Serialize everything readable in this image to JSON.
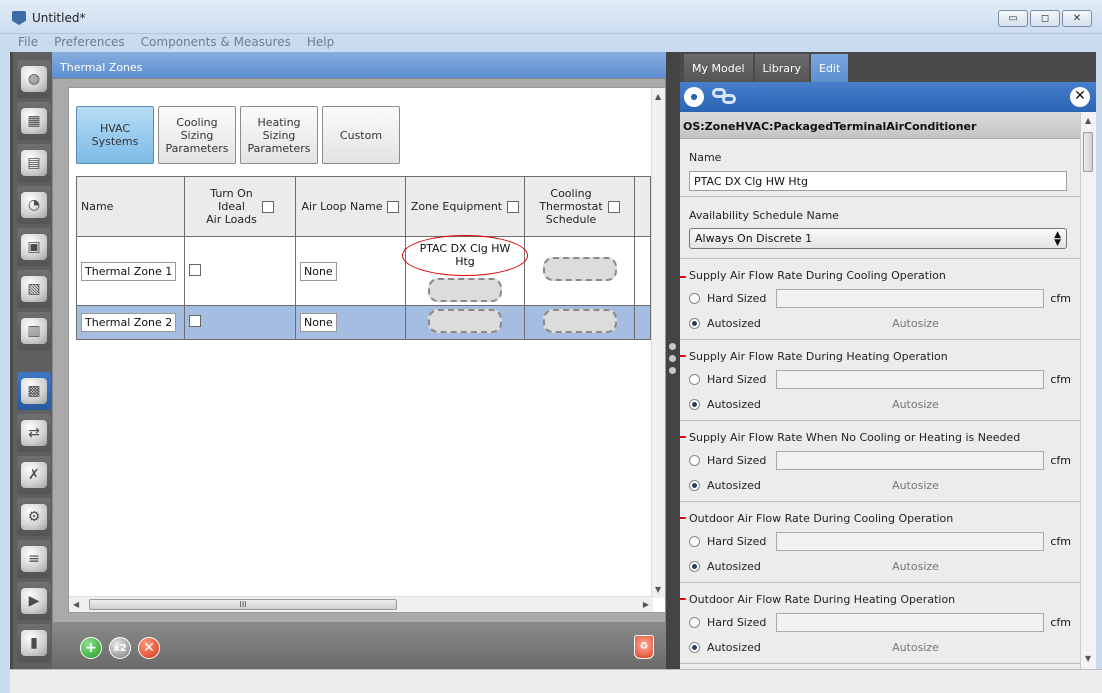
{
  "window": {
    "title": "Untitled*",
    "buttons": {
      "minimize": "▭",
      "maximize": "◻",
      "close": "✕"
    }
  },
  "menu": [
    "File",
    "Preferences",
    "Components & Measures",
    "Help"
  ],
  "left_toolbar": {
    "icons": [
      "globe-icon",
      "calendar-icon",
      "construction-icon",
      "loads-icon",
      "space-types-icon",
      "geometry-icon",
      "facility-icon",
      "thermal-zones-icon",
      "hvac-icon",
      "variables-icon",
      "simulation-settings-icon",
      "scripts-icon",
      "run-icon",
      "results-icon"
    ],
    "active_index": 7
  },
  "panel": {
    "header": "Thermal Zones",
    "subtabs": [
      "HVAC\nSystems",
      "Cooling\nSizing\nParameters",
      "Heating\nSizing\nParameters",
      "Custom"
    ],
    "active_subtab": 0,
    "columns": {
      "name": "Name",
      "ideal_loads": "Turn On\nIdeal\nAir Loads",
      "air_loop": "Air Loop Name",
      "zone_equipment": "Zone Equipment",
      "cooling_thermostat": "Cooling\nThermostat\nSchedule"
    },
    "rows": [
      {
        "name": "Thermal Zone 1",
        "air_loop": "None",
        "zone_equipment": "PTAC DX Clg HW Htg",
        "selected": false
      },
      {
        "name": "Thermal Zone 2",
        "air_loop": "None",
        "zone_equipment": "",
        "selected": true
      }
    ],
    "hscroll_label": "III"
  },
  "footer_buttons": {
    "add": "+",
    "copy": "x2",
    "delete": "✕",
    "purge": "♻"
  },
  "right_panel": {
    "tabs": [
      "My Model",
      "Library",
      "Edit"
    ],
    "active_tab": 2,
    "close_label": "✕",
    "object_type": "OS:ZoneHVAC:PackagedTerminalAirConditioner",
    "name_label": "Name",
    "name_value": "PTAC DX Clg HW Htg",
    "availability_label": "Availability Schedule Name",
    "availability_value": "Always On Discrete 1",
    "hard_sized_label": "Hard Sized",
    "autosized_label": "Autosized",
    "autosize_text": "Autosize",
    "unit": "cfm",
    "flow_fields": [
      "Supply Air Flow Rate During Cooling Operation",
      "Supply Air Flow Rate During Heating Operation",
      "Supply Air Flow Rate When No Cooling or Heating is Needed",
      "Outdoor Air Flow Rate During Cooling Operation",
      "Outdoor Air Flow Rate During Heating Operation"
    ]
  }
}
